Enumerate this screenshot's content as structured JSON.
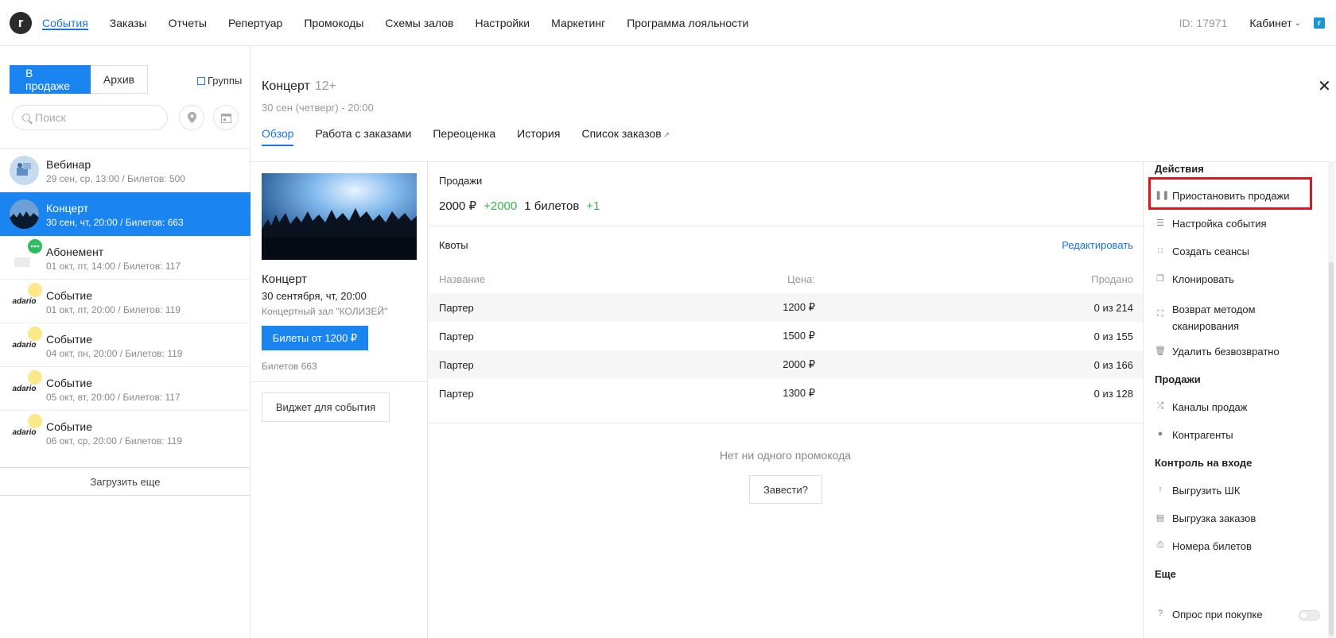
{
  "nav": {
    "logo": "r",
    "items": [
      {
        "label": "События",
        "active": true
      },
      {
        "label": "Заказы"
      },
      {
        "label": "Отчеты"
      },
      {
        "label": "Репертуар"
      },
      {
        "label": "Промокоды"
      },
      {
        "label": "Схемы залов"
      },
      {
        "label": "Настройки"
      },
      {
        "label": "Маркетинг"
      },
      {
        "label": "Программа лояльности"
      }
    ],
    "id_text": "ID: 17971",
    "cabinet": "Кабинет"
  },
  "sidebar": {
    "tab_on_sale": "В продаже",
    "tab_archive": "Архив",
    "groups_label": "Группы",
    "search_placeholder": "Поиск",
    "events": [
      {
        "name": "Вебинар",
        "sub": "29 сен, ср, 13:00 / Билетов: 500"
      },
      {
        "name": "Концерт",
        "sub": "30 сен, чт, 20:00 / Билетов: 663",
        "selected": true
      },
      {
        "name": "Абонемент",
        "sub": "01 окт, пт, 14:00 / Билетов: 117"
      },
      {
        "name": "Событие",
        "sub": "01 окт, пт, 20:00 / Билетов: 119"
      },
      {
        "name": "Событие",
        "sub": "04 окт, пн, 20:00 / Билетов: 119"
      },
      {
        "name": "Событие",
        "sub": "05 окт, вт, 20:00 / Билетов: 117"
      },
      {
        "name": "Событие",
        "sub": "06 окт, ср, 20:00 / Билетов: 119"
      }
    ],
    "thumb_logo_text": "adario",
    "load_more": "Загрузить еще"
  },
  "header": {
    "title": "Концерт",
    "age": "12+",
    "date": "30 сен (четверг) - 20:00",
    "tabs": [
      {
        "label": "Обзор",
        "active": true
      },
      {
        "label": "Работа с заказами"
      },
      {
        "label": "Переоценка"
      },
      {
        "label": "История"
      },
      {
        "label": "Список заказов"
      }
    ]
  },
  "card": {
    "title": "Концерт",
    "date": "30 сентября, чт, 20:00",
    "venue": "Концертный зал \"КОЛИЗЕЙ\"",
    "buy_label": "Билеты от 1200 ₽",
    "tickets": "Билетов 663",
    "widget_label": "Виджет для события"
  },
  "sales": {
    "label": "Продажи",
    "amount": "2000 ₽",
    "amount_delta": "+2000",
    "tickets": "1 билетов",
    "tickets_delta": "+1"
  },
  "quotas": {
    "label": "Квоты",
    "edit": "Редактировать",
    "columns": [
      "Название",
      "Цена:",
      "Продано"
    ],
    "rows": [
      [
        "Партер",
        "1200 ₽",
        "0 из 214"
      ],
      [
        "Партер",
        "1500 ₽",
        "0 из 155"
      ],
      [
        "Партер",
        "2000 ₽",
        "0 из 166"
      ],
      [
        "Партер",
        "1300 ₽",
        "0 из 128"
      ]
    ]
  },
  "promo": {
    "empty": "Нет ни одного промокода",
    "start": "Завести?"
  },
  "actions": {
    "sec_actions": "Действия",
    "pause": "Приостановить продажи",
    "settings": "Настройка события",
    "sessions": "Создать сеансы",
    "clone": "Клонировать",
    "refund_1": "Возврат методом",
    "refund_2": "сканирования",
    "delete": "Удалить безвозвратно",
    "sec_sales": "Продажи",
    "channels": "Каналы продаж",
    "contractors": "Контрагенты",
    "sec_entry": "Контроль на входе",
    "export_barcodes": "Выгрузить ШК",
    "export_orders": "Выгрузка заказов",
    "ticket_numbers": "Номера билетов",
    "sec_more": "Еще",
    "survey": "Опрос при покупке"
  },
  "colors": {
    "accent": "#1a84f0",
    "positive": "#3cb44b",
    "highlight": "#e0141a"
  }
}
